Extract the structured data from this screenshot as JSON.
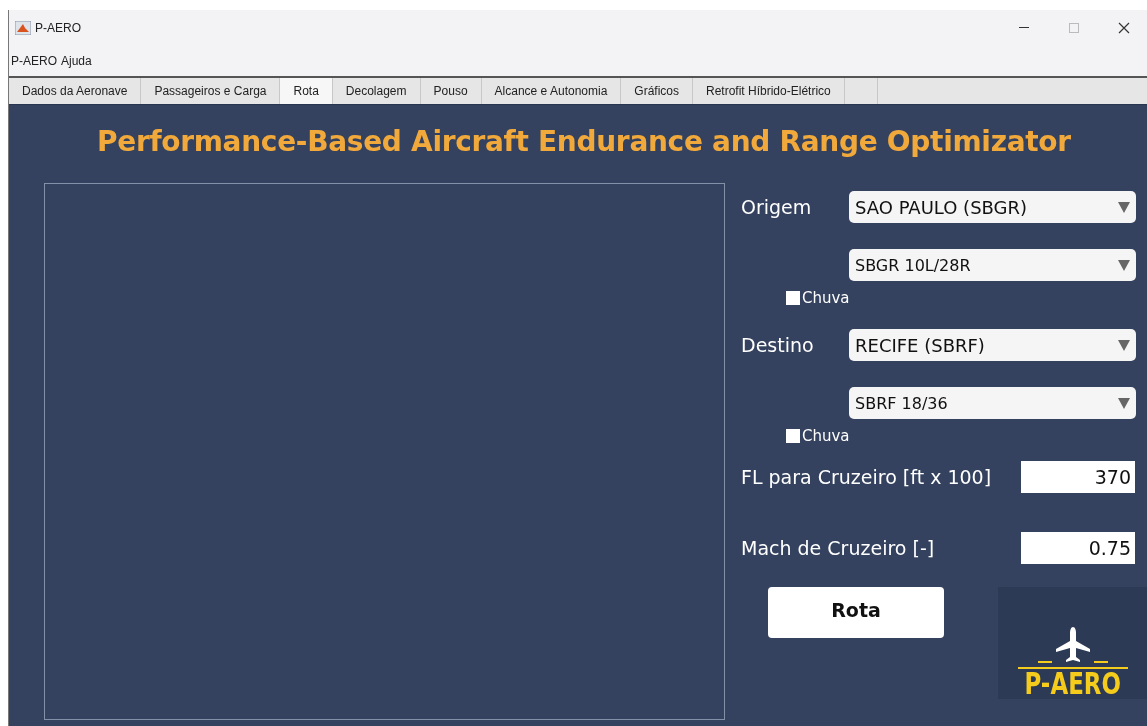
{
  "window": {
    "title": "P-AERO"
  },
  "menu": [
    "P-AERO",
    "Ajuda"
  ],
  "tabs": [
    {
      "label": "Dados da Aeronave",
      "selected": false
    },
    {
      "label": "Passageiros e Carga",
      "selected": false
    },
    {
      "label": "Rota",
      "selected": true
    },
    {
      "label": "Decolagem",
      "selected": false
    },
    {
      "label": "Pouso",
      "selected": false
    },
    {
      "label": "Alcance e Autonomia",
      "selected": false
    },
    {
      "label": "Gráficos",
      "selected": false
    },
    {
      "label": "Retrofit Híbrido-Elétrico",
      "selected": false
    }
  ],
  "heading": "Performance-Based Aircraft Endurance and Range Optimizator",
  "origin": {
    "label": "Origem",
    "airport": "SAO PAULO (SBGR)",
    "runway": "SBGR 10L/28R",
    "rain": {
      "label": "Chuva",
      "checked": false
    }
  },
  "destination": {
    "label": "Destino",
    "airport": "RECIFE (SBRF)",
    "runway": "SBRF 18/36",
    "rain": {
      "label": "Chuva",
      "checked": false
    }
  },
  "fields": [
    {
      "label": "FL para Cruzeiro [ft x 100]",
      "value": "370"
    },
    {
      "label": "Mach de Cruzeiro [-]",
      "value": "0.75"
    }
  ],
  "button": "Rota",
  "logo": "P-AERO"
}
